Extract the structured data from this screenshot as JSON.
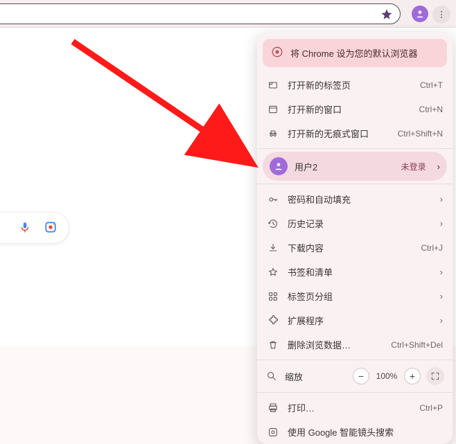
{
  "toolbar": {
    "star_name": "bookmark-star-icon",
    "avatar_name": "profile-avatar",
    "more_name": "kebab-menu"
  },
  "banner": {
    "label": "将 Chrome 设为您的默认浏览器"
  },
  "menu": {
    "new_tab": {
      "label": "打开新的标签页",
      "shortcut": "Ctrl+T"
    },
    "new_win": {
      "label": "打开新的窗口",
      "shortcut": "Ctrl+N"
    },
    "incognito": {
      "label": "打开新的无痕式窗口",
      "shortcut": "Ctrl+Shift+N"
    },
    "user": {
      "label": "用户2",
      "status": "未登录"
    },
    "passwords": {
      "label": "密码和自动填充"
    },
    "history": {
      "label": "历史记录"
    },
    "downloads": {
      "label": "下载内容",
      "shortcut": "Ctrl+J"
    },
    "bookmarks": {
      "label": "书签和清单"
    },
    "tabgroups": {
      "label": "标签页分组"
    },
    "extensions": {
      "label": "扩展程序"
    },
    "cleardata": {
      "label": "删除浏览数据…",
      "shortcut": "Ctrl+Shift+Del"
    },
    "zoom": {
      "label": "缩放",
      "value": "100%"
    },
    "print": {
      "label": "打印…",
      "shortcut": "Ctrl+P"
    },
    "lens": {
      "label": "使用 Google 智能镜头搜索"
    }
  }
}
